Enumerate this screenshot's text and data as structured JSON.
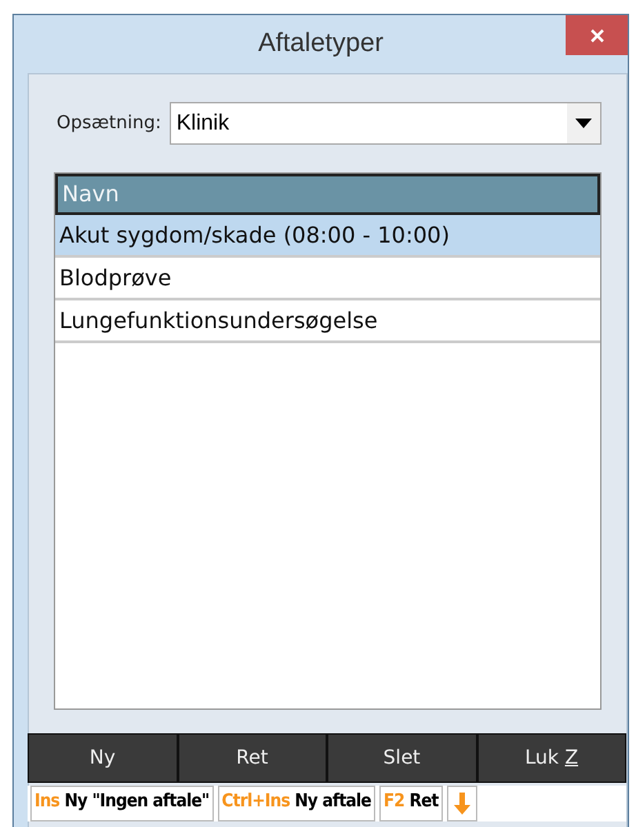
{
  "window": {
    "title": "Aftaletyper"
  },
  "setup": {
    "label": "Opsætning:",
    "value": "Klinik"
  },
  "table": {
    "columns": [
      "Navn"
    ],
    "rows": [
      {
        "name": "Akut sygdom/skade (08:00 - 10:00)",
        "selected": true
      },
      {
        "name": "Blodprøve",
        "selected": false
      },
      {
        "name": "Lungefunktionsundersøgelse",
        "selected": false
      }
    ]
  },
  "buttons": [
    {
      "label": "Ny"
    },
    {
      "label": "Ret"
    },
    {
      "label": "Slet"
    },
    {
      "label": "Luk",
      "shortcut": "Z"
    }
  ],
  "status_bar": [
    {
      "key": "Ins",
      "text": "Ny \"Ingen aftale\""
    },
    {
      "key": "Ctrl+Ins",
      "text": "Ny aftale"
    },
    {
      "key": "F2",
      "text": "Ret"
    }
  ]
}
